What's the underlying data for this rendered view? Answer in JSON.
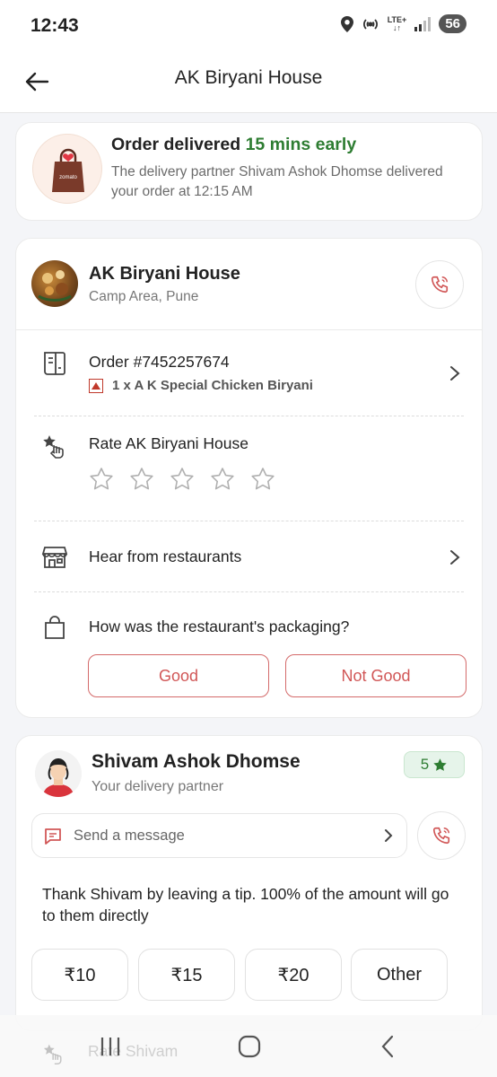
{
  "status_bar": {
    "time": "12:43",
    "network_label_top": "LTE+",
    "battery": "56"
  },
  "header": {
    "title": "AK Biryani House"
  },
  "delivery_card": {
    "status_prefix": "Order delivered",
    "status_highlight": "15 mins early",
    "detail": "The delivery partner Shivam Ashok Dhomse delivered your order at 12:15 AM",
    "bag_brand": "zomato"
  },
  "restaurant_card": {
    "name": "AK Biryani House",
    "area": "Camp Area, Pune",
    "order_label": "Order #7452257674",
    "order_item": "1 x A K Special Chicken Biryani",
    "rate_label": "Rate AK Biryani House",
    "star_count": 5,
    "hear_label": "Hear from restaurants",
    "packaging_question": "How was the restaurant's packaging?",
    "good_label": "Good",
    "not_good_label": "Not Good"
  },
  "partner_card": {
    "name": "Shivam Ashok Dhomse",
    "subtitle": "Your delivery partner",
    "rating": "5",
    "message_placeholder": "Send a message",
    "tip_text": "Thank Shivam by leaving a tip. 100% of the amount will go to them directly",
    "tips": [
      "₹10",
      "₹15",
      "₹20",
      "Other"
    ],
    "rate_partner_label": "Rate Shivam"
  },
  "colors": {
    "accent_red": "#d15757",
    "green": "#2e7d32"
  }
}
